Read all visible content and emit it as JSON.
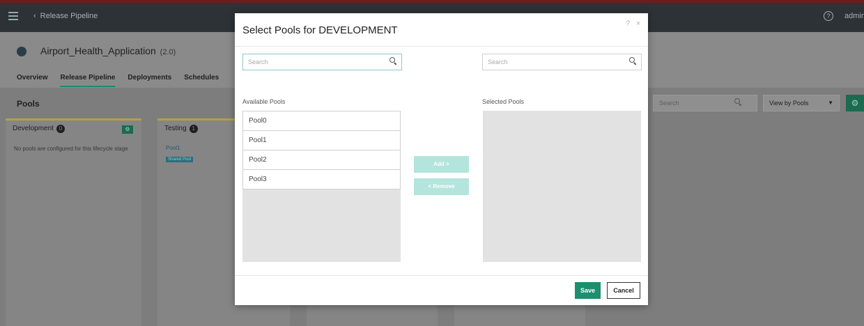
{
  "topbar": {
    "back_label": "Release Pipeline",
    "user": "admin"
  },
  "app": {
    "name": "Airport_Health_Application",
    "version": "(2.0)"
  },
  "nav_tabs": [
    {
      "label": "Overview",
      "active": false
    },
    {
      "label": "Release Pipeline",
      "active": true
    },
    {
      "label": "Deployments",
      "active": false
    },
    {
      "label": "Schedules",
      "active": false
    }
  ],
  "pools_section": {
    "title": "Pools",
    "search_placeholder": "Search",
    "view_select": "View by Pools"
  },
  "stages": [
    {
      "name": "Development",
      "count": "0",
      "message": "No pools are configured for this lifecycle stage"
    },
    {
      "name": "Testing",
      "count": "1",
      "pool": "Pool1",
      "pool_badge": "Shared Pool"
    }
  ],
  "modal": {
    "title": "Select Pools for DEVELOPMENT",
    "help": "?",
    "close": "×",
    "left_search_placeholder": "Search",
    "right_search_placeholder": "Search",
    "available_label": "Available Pools",
    "selected_label": "Selected Pools",
    "available_pools": [
      "Pool0",
      "Pool1",
      "Pool2",
      "Pool3"
    ],
    "selected_pools": [],
    "add_label": "Add >",
    "remove_label": "< Remove",
    "save_label": "Save",
    "cancel_label": "Cancel"
  },
  "colors": {
    "accent": "#1b8f6e",
    "transfer_disabled": "#b3e5dc",
    "overlay": "#7d7d7d"
  }
}
